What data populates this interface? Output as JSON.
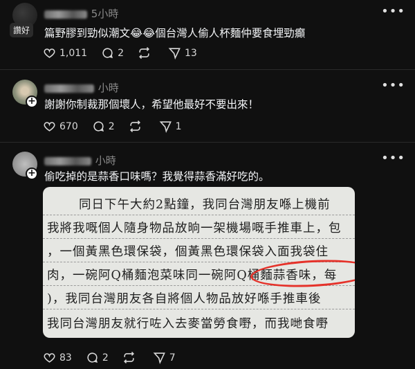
{
  "posts": [
    {
      "time": "5小時",
      "badge": "讚好",
      "text": "篇野膠到勁似潮文😂😂個台灣人偷人杯麵仲要食埋勁癲",
      "likes": "1,011",
      "replies": "2",
      "reposts": "",
      "shares": "13"
    },
    {
      "time": "小時",
      "text": "謝謝你制裁那個壞人，希望他最好不要出來！",
      "likes": "670",
      "replies": "2",
      "reposts": "",
      "shares": "1"
    },
    {
      "time": "小時",
      "text": "偷吃掉的是蒜香口味嗎？我覺得蒜香滿好吃的。",
      "likes": "83",
      "replies": "2",
      "reposts": "",
      "shares": "7",
      "document_lines": [
        "同日下午大約2點鐘，我同台灣朋友喺上機前",
        "我將我嘅個人隨身物品放晌一架機場嘅手推車上，包",
        "，一個黃黑色環保袋，個黃黑色環保袋入面我袋住",
        "肉，一碗阿Q桶麵泡菜味同一碗阿Q桶麵蒜香味，每",
        ")，我同台灣朋友各自將個人物品放好喺手推車後",
        "我同台灣朋友就行咗入去麥當勞食嘢，而我哋食嘢"
      ]
    }
  ],
  "more_icon": "more-horizontal-icon",
  "colors": {
    "background": "#101010",
    "text": "#f3f5f7",
    "muted": "#8a8a8a",
    "highlight_circle": "#e5322a",
    "paper": "#e6e7e3"
  }
}
